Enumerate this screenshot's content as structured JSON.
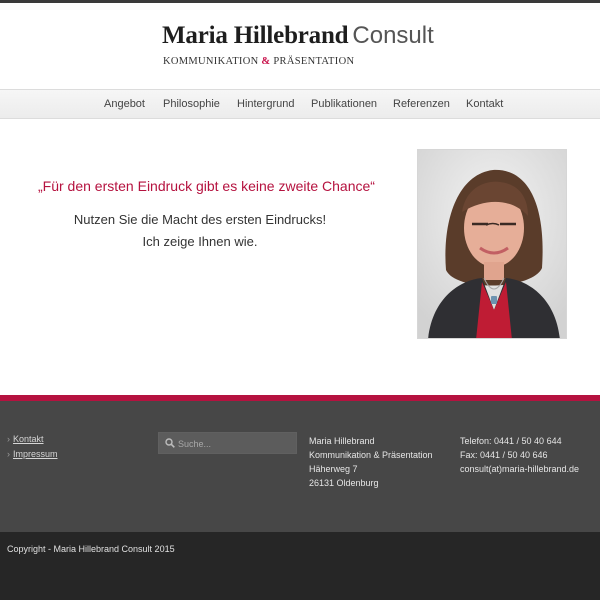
{
  "header": {
    "logo_main": "Maria Hillebrand",
    "logo_consult": "Consult",
    "tagline_part1": "KOMMUNIKATION",
    "tagline_amp": "&",
    "tagline_part2": "PRÄSENTATION"
  },
  "nav": {
    "items": [
      {
        "label": "Angebot"
      },
      {
        "label": "Philosophie"
      },
      {
        "label": "Hintergrund"
      },
      {
        "label": "Publikationen"
      },
      {
        "label": "Referenzen"
      },
      {
        "label": "Kontakt"
      }
    ]
  },
  "hero": {
    "quote": "„Für den ersten Eindruck gibt es keine zweite Chance“",
    "line1": "Nutzen Sie die Macht des ersten Eindrucks!",
    "line2": "Ich zeige Ihnen wie."
  },
  "footer": {
    "links": [
      {
        "label": "Kontakt"
      },
      {
        "label": "Impressum"
      }
    ],
    "search": {
      "placeholder": "Suche..."
    },
    "address": [
      "Maria Hillebrand",
      "Kommunikation & Präsentation",
      "Häherweg 7",
      "26131 Oldenburg"
    ],
    "contact": [
      "Telefon: 0441 / 50 40 644",
      "Fax: 0441 / 50 40 646",
      "consult(at)maria-hillebrand.de"
    ],
    "copyright": "Copyright - Maria Hillebrand Consult 2015"
  },
  "colors": {
    "accent": "#b5123f",
    "footer_bg": "#474747",
    "copyright_bg": "#262626"
  }
}
